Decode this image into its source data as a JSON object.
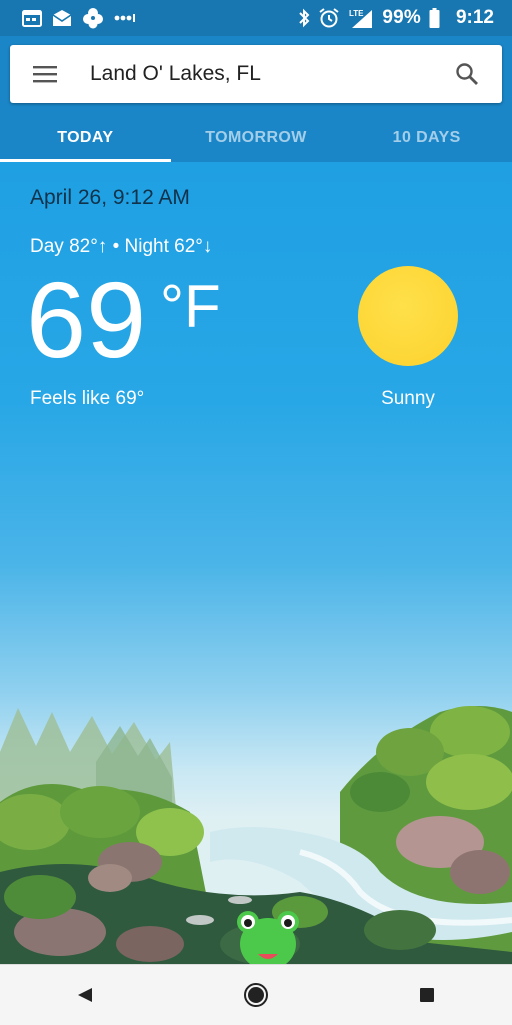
{
  "status_bar": {
    "battery": "99%",
    "time": "9:12",
    "network": "LTE",
    "icons_left": [
      "calendar-icon",
      "mail-icon",
      "flower-icon",
      "more-dots-icon"
    ],
    "icons_right": [
      "bluetooth-icon",
      "alarm-icon",
      "signal-icon",
      "battery-icon"
    ]
  },
  "search": {
    "location": "Land O' Lakes, FL"
  },
  "tabs": [
    {
      "label": "TODAY",
      "active": true
    },
    {
      "label": "TOMORROW",
      "active": false
    },
    {
      "label": "10 DAYS",
      "active": false
    }
  ],
  "weather": {
    "datetime": "April 26, 9:12 AM",
    "day_night": "Day 82°↑ • Night 62°↓",
    "temperature": "69",
    "unit": "°F",
    "feels_like": "Feels like 69°",
    "condition": "Sunny"
  },
  "colors": {
    "status_bar": "#1877b0",
    "app_bar": "#1a86c8",
    "sun": "#fcd22d",
    "frog": "#4cc94a"
  }
}
